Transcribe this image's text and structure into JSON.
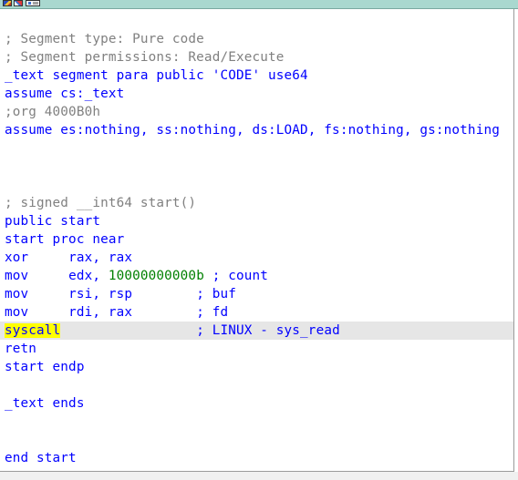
{
  "window": {
    "icons": [
      "graph-view-icon",
      "edit-icon",
      "hex-view-icon"
    ]
  },
  "listing": {
    "l1": "; Segment type: Pure code",
    "l2": "; Segment permissions: Read/Execute",
    "l3": "_text segment para public 'CODE' use64",
    "l4": "assume cs:_text",
    "l5": ";org 4000B0h",
    "l6": "assume es:nothing, ss:nothing, ds:LOAD, fs:nothing, gs:nothing",
    "l7": "; signed __int64 start()",
    "l8": "public start",
    "l9": "start proc near",
    "l10_mn": "xor     ",
    "l10_op": "rax, rax",
    "l11_mn": "mov     ",
    "l11_op": "edx, ",
    "l11_num": "10000000000b",
    "l11_cmt": " ; count",
    "l12_mn": "mov     ",
    "l12_op": "rsi, rsp        ",
    "l12_cmt": "; buf",
    "l13_mn": "mov     ",
    "l13_op": "rdi, rax        ",
    "l13_cmt": "; fd",
    "l14_mn": "syscall",
    "l14_pad": "                 ",
    "l14_cmt": "; LINUX - sys_read",
    "l15": "retn",
    "l16": "start endp",
    "l17": "_text ends",
    "l18": "end start"
  },
  "colors": {
    "keyword": "#0000ff",
    "comment": "#808080",
    "number": "#008000",
    "highlight": "#ffff00",
    "current_line": "#e6e6e6"
  }
}
